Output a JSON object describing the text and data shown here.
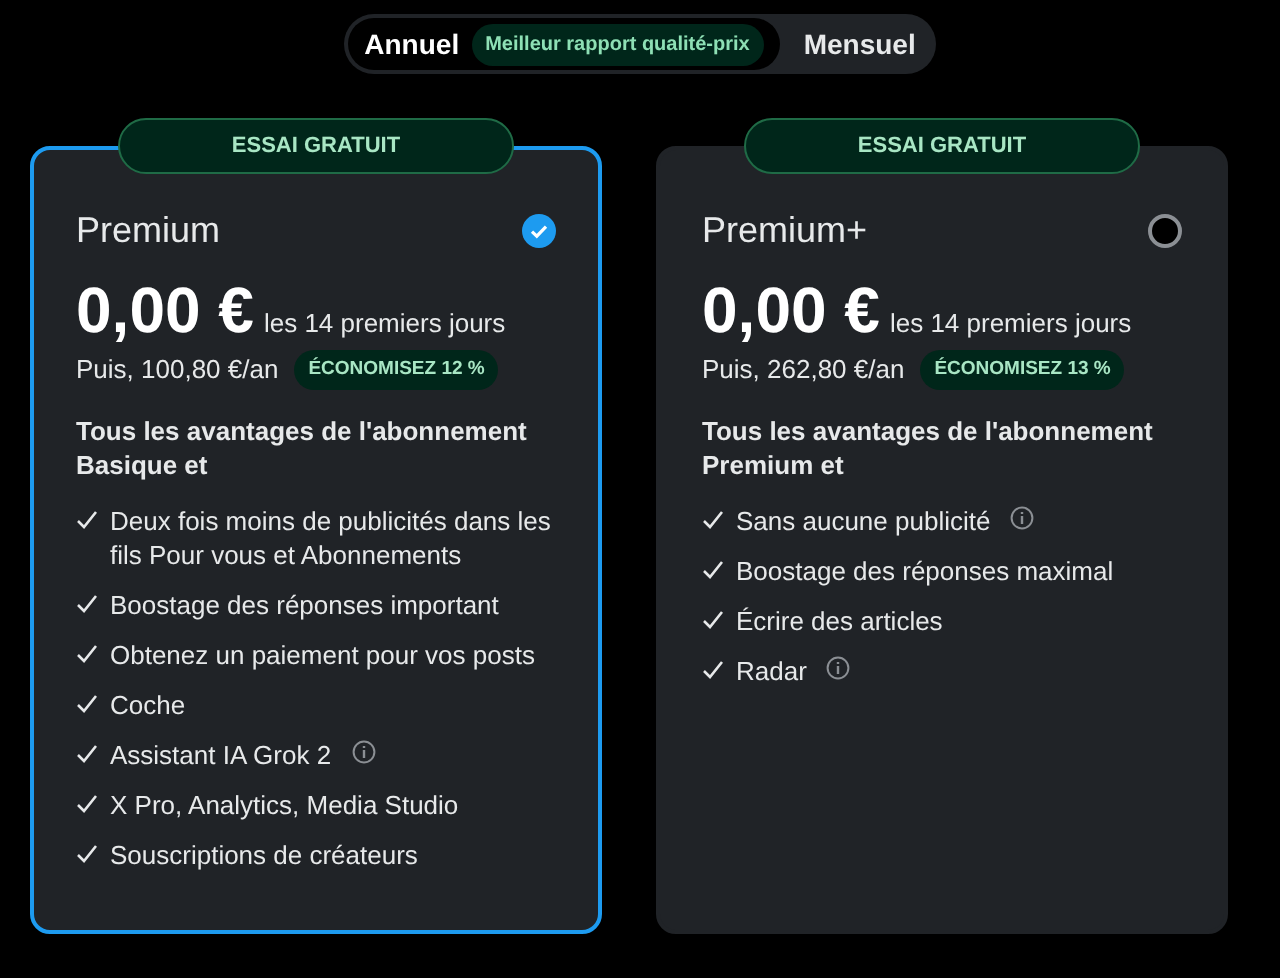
{
  "billing_toggle": [
    {
      "label": "Annuel",
      "selected": true,
      "badge": "Meilleur rapport qualité-prix"
    },
    {
      "label": "Mensuel",
      "selected": false
    }
  ],
  "plans": [
    {
      "badge": "ESSAI GRATUIT",
      "name": "Premium",
      "selected": true,
      "price": "0,00 €",
      "price_note": "les 14 premiers jours",
      "then": "Puis, 100,80 €/an",
      "savings": "ÉCONOMISEZ 12 %",
      "intro": "Tous les avantages de l'abonnement Basique et",
      "features": [
        {
          "text": "Deux fois moins de publicités dans les fils Pour vous et Abonnements",
          "info": false
        },
        {
          "text": "Boostage des réponses important",
          "info": false
        },
        {
          "text": "Obtenez un paiement pour vos posts",
          "info": false
        },
        {
          "text": "Coche",
          "info": false
        },
        {
          "text": "Assistant IA Grok 2",
          "info": true
        },
        {
          "text": "X Pro, Analytics, Media Studio",
          "info": false
        },
        {
          "text": "Souscriptions de créateurs",
          "info": false
        }
      ]
    },
    {
      "badge": "ESSAI GRATUIT",
      "name": "Premium+",
      "selected": false,
      "price": "0,00 €",
      "price_note": "les 14 premiers jours",
      "then": "Puis, 262,80 €/an",
      "savings": "ÉCONOMISEZ 13 %",
      "intro": "Tous les avantages de l'abonnement Premium et",
      "features": [
        {
          "text": "Sans aucune publicité",
          "info": true
        },
        {
          "text": "Boostage des réponses maximal",
          "info": false
        },
        {
          "text": "Écrire des articles",
          "info": false
        },
        {
          "text": "Radar",
          "info": true
        }
      ]
    }
  ]
}
